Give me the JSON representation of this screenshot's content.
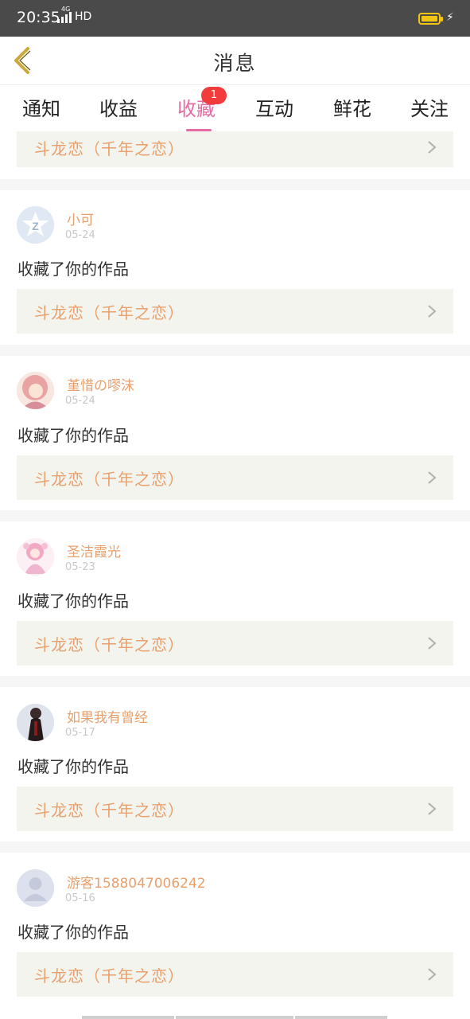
{
  "status_bar": {
    "time": "20:35",
    "network": "4G",
    "hd": "HD"
  },
  "header": {
    "title": "消息"
  },
  "tabs": [
    {
      "label": "通知"
    },
    {
      "label": "收益"
    },
    {
      "label": "收藏",
      "badge": "1",
      "active": true
    },
    {
      "label": "互动"
    },
    {
      "label": "鲜花"
    },
    {
      "label": "关注"
    }
  ],
  "partial_card": {
    "work_title": "斗龙恋（千年之恋）"
  },
  "items": [
    {
      "user": "小可",
      "date": "05-24",
      "action": "收藏了你的作品",
      "work_title": "斗龙恋（千年之恋）",
      "avatar": "z-logo-avatar"
    },
    {
      "user": "堇惜の嘐沫",
      "date": "05-24",
      "action": "收藏了你的作品",
      "work_title": "斗龙恋（千年之恋）",
      "avatar": "pink-hair-girl-avatar"
    },
    {
      "user": "圣洁霞光",
      "date": "05-23",
      "action": "收藏了你的作品",
      "work_title": "斗龙恋（千年之恋）",
      "avatar": "pink-anime-avatar"
    },
    {
      "user": "如果我有曾经",
      "date": "05-17",
      "action": "收藏了你的作品",
      "work_title": "斗龙恋（千年之恋）",
      "avatar": "dark-figure-avatar"
    },
    {
      "user": "游客1588047006242",
      "date": "05-16",
      "action": "收藏了你的作品",
      "work_title": "斗龙恋（千年之恋）",
      "avatar": "default-user-avatar"
    }
  ],
  "colors": {
    "accent": "#e86aa2",
    "work_title": "#e9a06c",
    "badge": "#f23c3c",
    "back_arrow": "#c8a93a"
  }
}
